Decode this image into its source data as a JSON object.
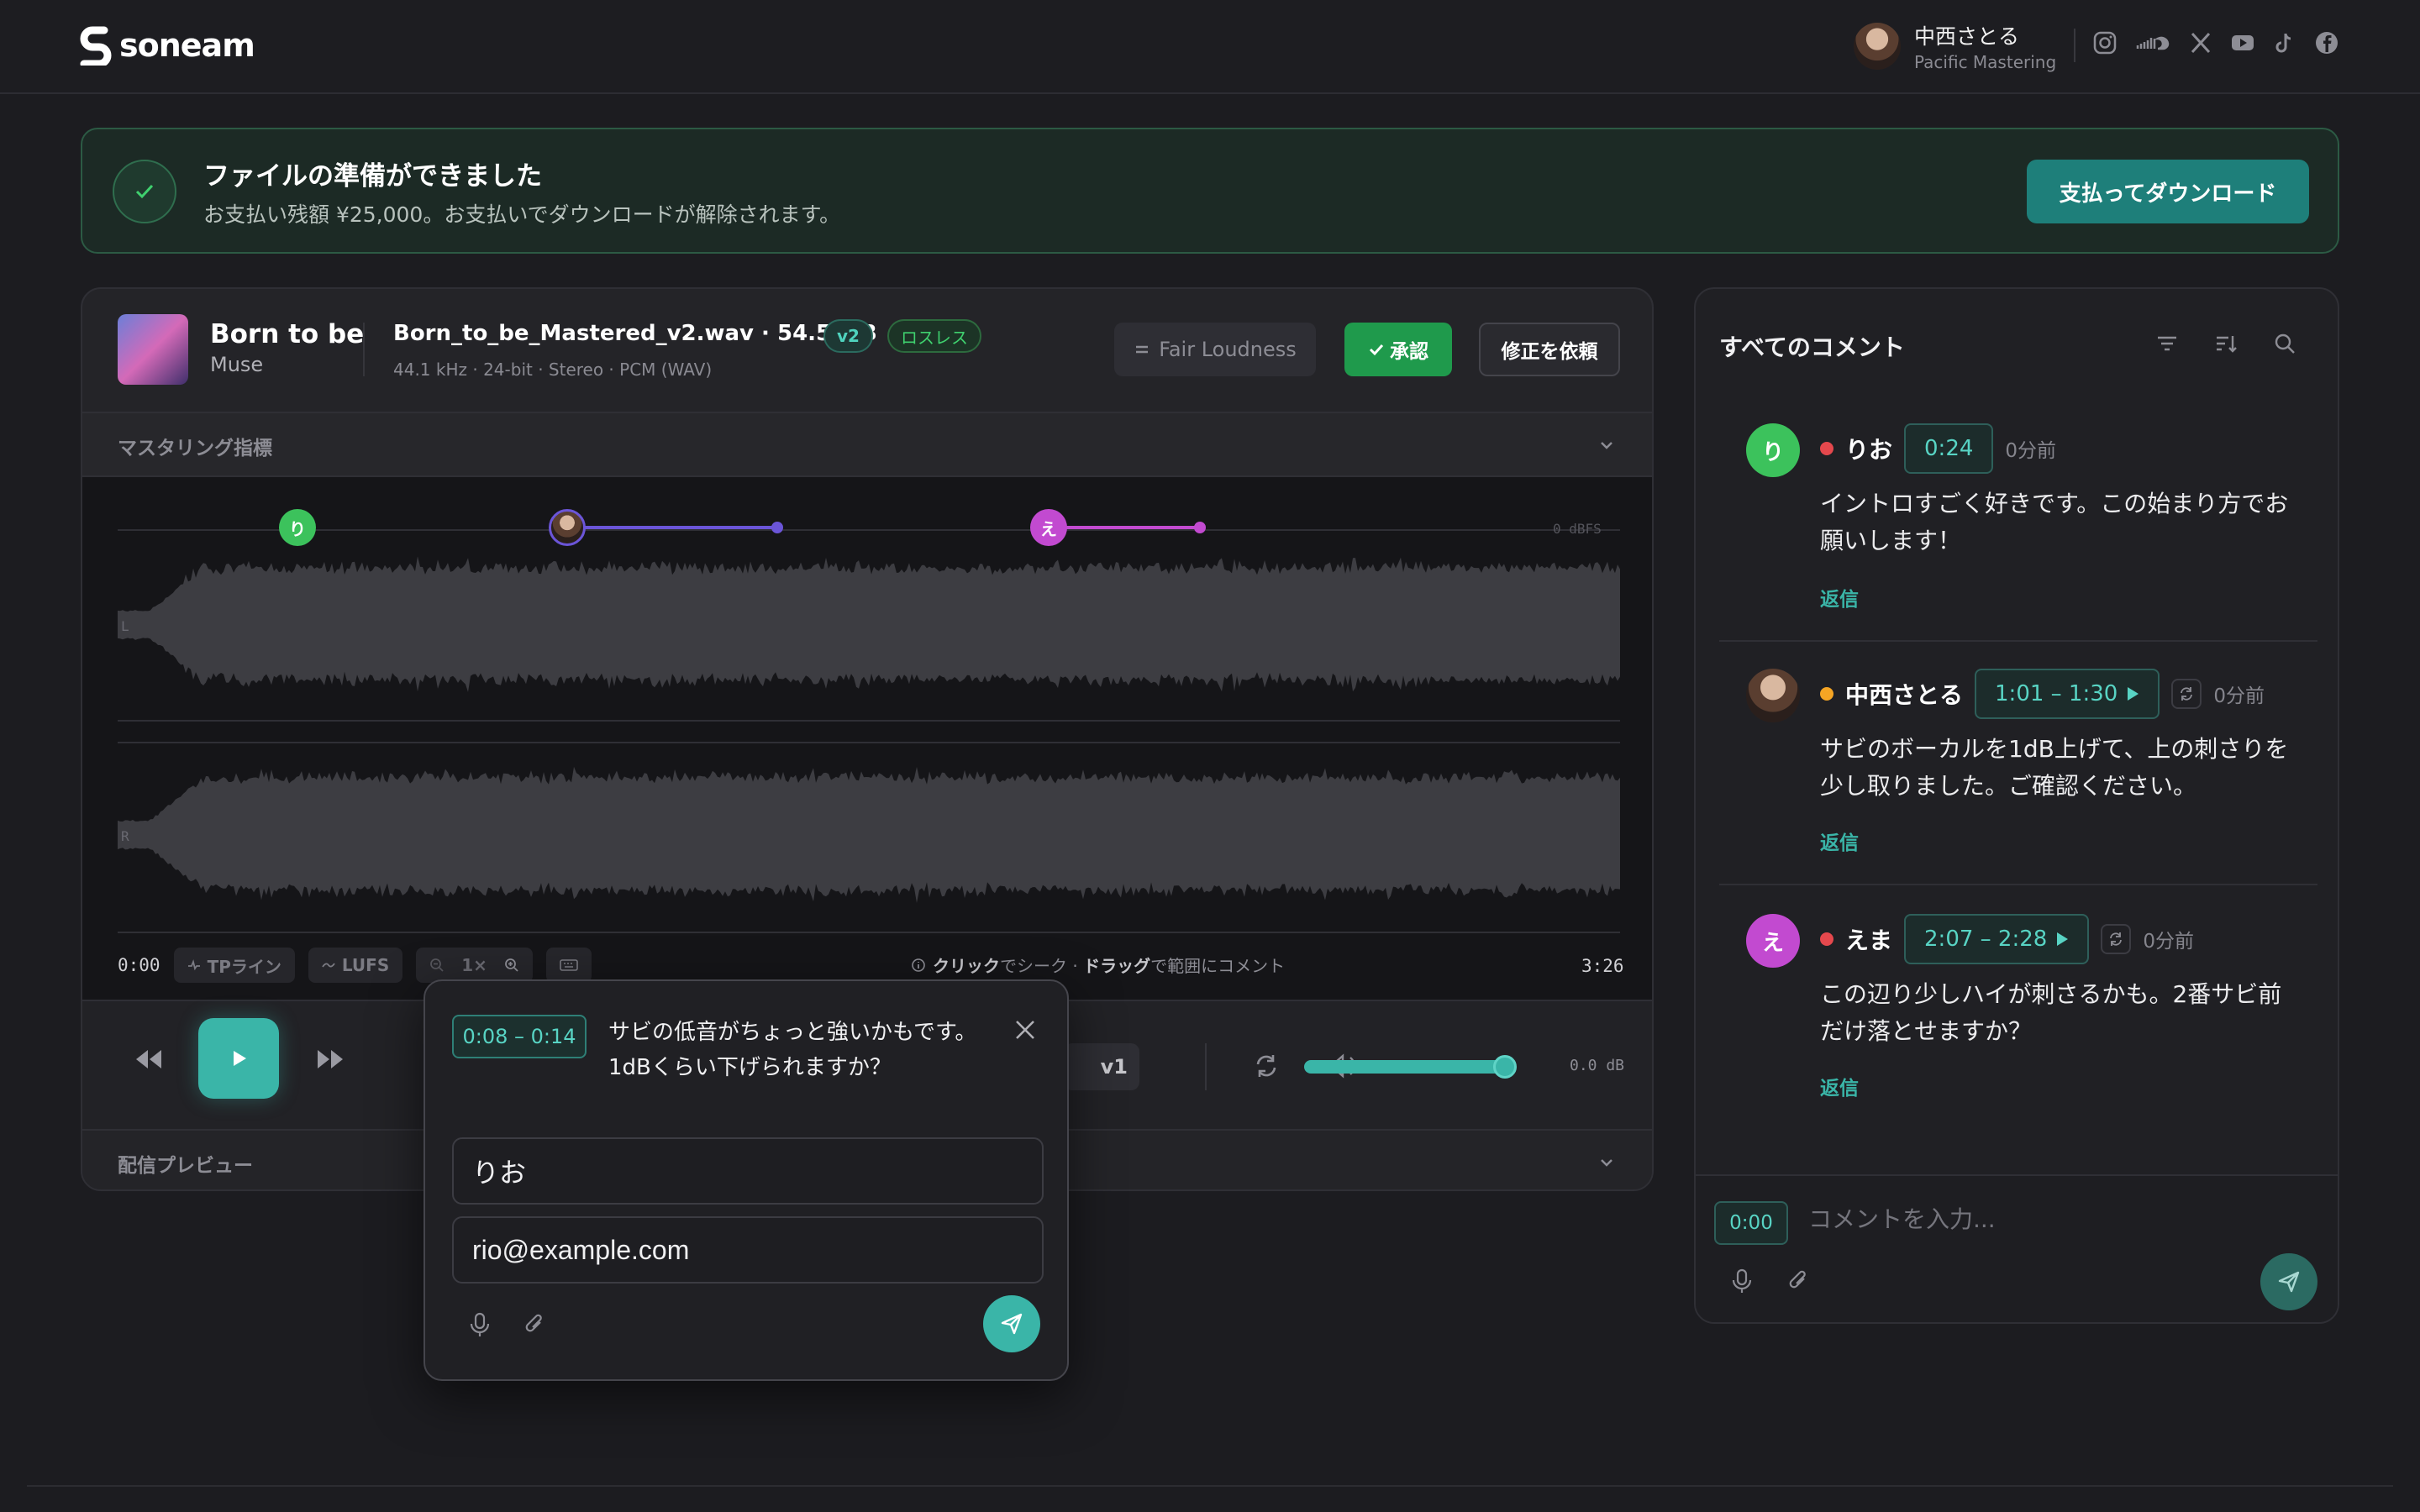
{
  "header": {
    "logo_text": "soneam",
    "user_name": "中西さとる",
    "user_org": "Pacific Mastering",
    "socials": [
      "instagram-icon",
      "soundcloud-icon",
      "x-icon",
      "youtube-icon",
      "tiktok-icon",
      "facebook-icon"
    ]
  },
  "banner": {
    "title": "ファイルの準備ができました",
    "subtitle": "お支払い残額 ¥25,000。お支払いでダウンロードが解除されます。",
    "pay_button": "支払ってダウンロード"
  },
  "player": {
    "track_title": "Born to be",
    "artist": "Muse",
    "file_name": "Born_to_be_Mastered_v2.wav · 54.5 MB",
    "version_badge": "v2",
    "lossless_badge": "ロスレス",
    "file_meta": "44.1 kHz · 24-bit · Stereo · PCM (WAV)",
    "fair_loudness": "Fair Loudness",
    "approve": "承認",
    "request_revision": "修正を依頼",
    "metrics_label": "マスタリング指標",
    "dbfs_label": "0 dBFS",
    "channel_l": "L",
    "channel_r": "R",
    "marker_rio": "り",
    "marker_ema": "え",
    "time_start": "0:00",
    "time_end": "3:26",
    "tp_line": "TPライン",
    "lufs": "LUFS",
    "zoom": "1×",
    "hint_click": "クリック",
    "hint_seek": "でシーク · ",
    "hint_drag": "ドラッグ",
    "hint_range": "で範囲にコメント",
    "version_select": "v1",
    "volume_db": "0.0 dB",
    "volume_level": 0.92,
    "distribution_label": "配信プレビュー"
  },
  "popup": {
    "range": "0:08 – 0:14",
    "text": "サビの低音がちょっと強いかもです。1dBくらい下げられますか？",
    "name_value": "りお",
    "email_value": "rio@example.com"
  },
  "comments": {
    "title": "すべてのコメント",
    "items": [
      {
        "initial": "り",
        "name": "りお",
        "time": "0:24",
        "ago": "0分前",
        "body": "イントロすごく好きです。この始まり方でお願いします！",
        "reply": "返信",
        "avatar_color": "#3cc25c",
        "dot_color": "#e5484d"
      },
      {
        "initial": "",
        "name": "中西さとる",
        "time": "1:01 – 1:30",
        "ago": "0分前",
        "body": "サビのボーカルを1dB上げて、上の刺さりを少し取りました。ご確認ください。",
        "reply": "返信",
        "avatar_color": "#5a3e30",
        "dot_color": "#f5a524"
      },
      {
        "initial": "え",
        "name": "えま",
        "time": "2:07 – 2:28",
        "ago": "0分前",
        "body": "この辺り少しハイが刺さるかも。2番サビ前だけ落とせますか？",
        "reply": "返信",
        "avatar_color": "#c24ad0",
        "dot_color": "#e5484d"
      }
    ],
    "input_time": "0:00",
    "input_placeholder": "コメントを入力..."
  }
}
